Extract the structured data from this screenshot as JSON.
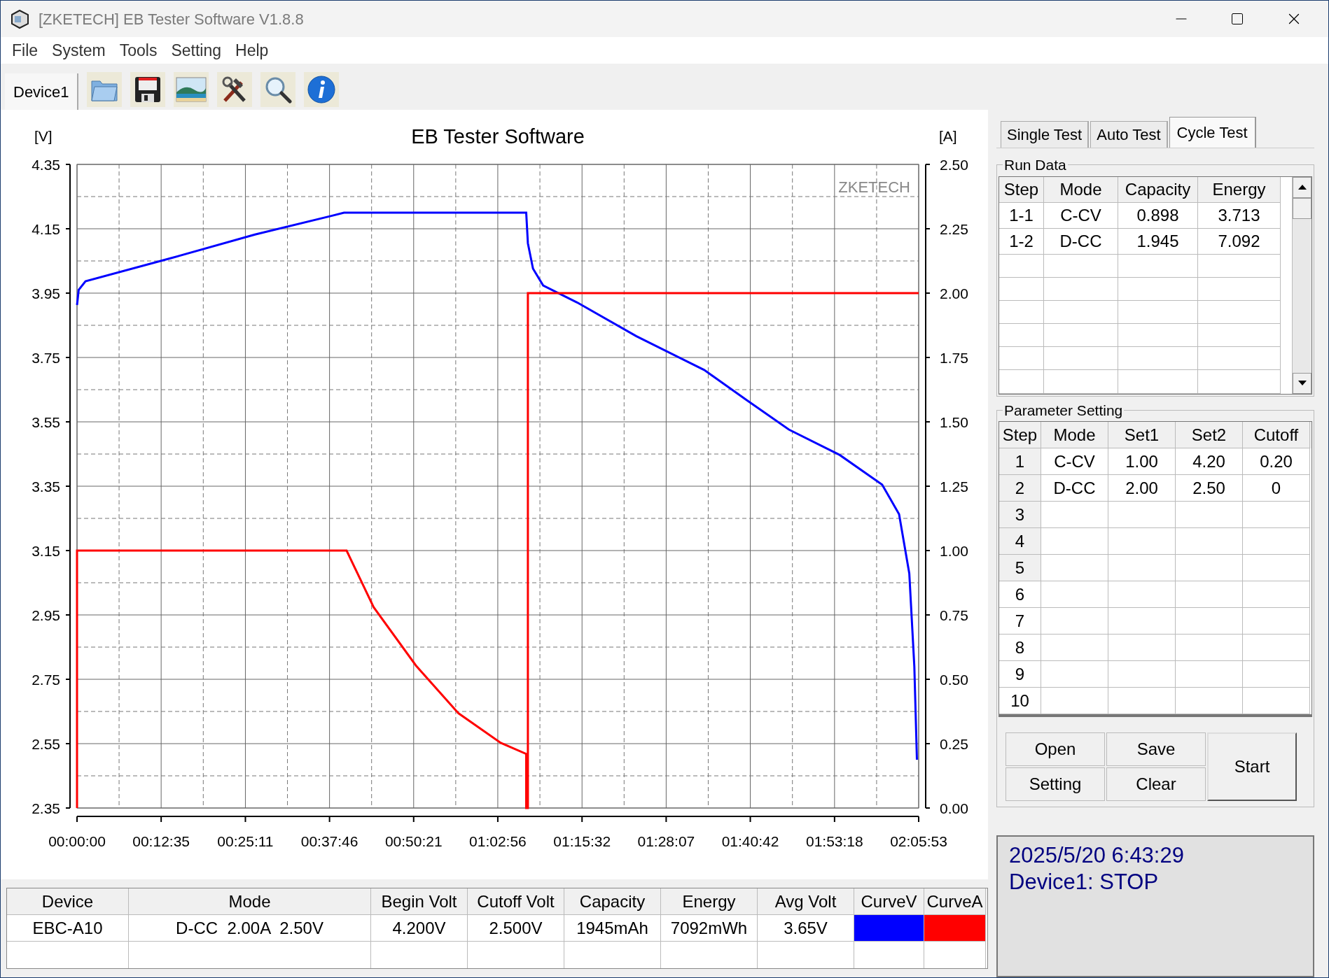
{
  "window": {
    "title": "[ZKETECH] EB Tester Software V1.8.8"
  },
  "menu": [
    "File",
    "System",
    "Tools",
    "Setting",
    "Help"
  ],
  "toolbar": {
    "device_tabs": [
      {
        "label": "Device1",
        "selected": true
      }
    ],
    "tools": [
      {
        "kind": "folder"
      },
      {
        "kind": "save"
      },
      {
        "kind": "picture"
      },
      {
        "kind": "tools"
      },
      {
        "kind": "search"
      },
      {
        "kind": "info"
      }
    ]
  },
  "chart": {
    "left_unit": "[V]",
    "right_unit": "[A]",
    "brand_label": "ZKETECH",
    "chart_data": {
      "type": "line",
      "title": "EB Tester Software",
      "grid": true,
      "y2lim": [
        0,
        2.5
      ],
      "y2ticks": [
        {
          "value": 0,
          "label": "0.00"
        },
        {
          "value": 0.25,
          "label": "0.25"
        },
        {
          "value": 0.5,
          "label": "0.50"
        },
        {
          "value": 0.75,
          "label": "0.75"
        },
        {
          "value": 1,
          "label": "1.00"
        },
        {
          "value": 1.25,
          "label": "1.25"
        },
        {
          "value": 1.5,
          "label": "1.50"
        },
        {
          "value": 1.75,
          "label": "1.75"
        },
        {
          "value": 2,
          "label": "2.00"
        },
        {
          "value": 2.25,
          "label": "2.25"
        },
        {
          "value": 2.5,
          "label": "2.50"
        }
      ],
      "x": [
        0,
        0,
        15,
        76,
        837,
        1597,
        2282,
        2396,
        2419,
        2662,
        3042,
        3423,
        3803,
        4031,
        4031,
        4046,
        4046,
        4092,
        4183,
        4487,
        5020,
        5628,
        6008,
        6388,
        6845,
        7225,
        7377,
        7469,
        7514,
        7537,
        7553
      ],
      "series": [
        {
          "name": "CurveV",
          "color": "#0000ff",
          "axis": "y",
          "values": [
            3.913,
            3.913,
            3.96,
            3.987,
            4.058,
            4.132,
            4.19,
            4.2,
            4.2,
            4.2,
            4.2,
            4.2,
            4.2,
            4.2,
            4.2,
            4.105,
            4.105,
            4.026,
            3.974,
            3.921,
            3.816,
            3.711,
            3.618,
            3.526,
            3.447,
            3.355,
            3.263,
            3.079,
            2.79,
            2.5,
            null
          ]
        },
        {
          "name": "CurveA",
          "color": "#ff0000",
          "axis": "y2",
          "values": [
            0,
            1,
            1,
            1,
            1,
            1,
            1,
            1,
            1,
            0.78,
            0.553,
            0.368,
            0.253,
            0.21,
            0,
            0,
            2,
            2,
            2,
            2,
            2,
            2,
            2,
            2,
            2,
            2,
            2,
            2,
            2,
            2,
            2
          ]
        }
      ],
      "xlim": [
        0,
        7553
      ],
      "ylim": [
        2.35,
        4.35
      ],
      "xticks": [
        {
          "value": 0,
          "label": "00:00:00"
        },
        {
          "value": 755,
          "label": "00:12:35"
        },
        {
          "value": 1511,
          "label": "00:25:11"
        },
        {
          "value": 2266,
          "label": "00:37:46"
        },
        {
          "value": 3021,
          "label": "00:50:21"
        },
        {
          "value": 3776,
          "label": "01:02:56"
        },
        {
          "value": 4532,
          "label": "01:15:32"
        },
        {
          "value": 5287,
          "label": "01:28:07"
        },
        {
          "value": 6042,
          "label": "01:40:42"
        },
        {
          "value": 6798,
          "label": "01:53:18"
        },
        {
          "value": 7553,
          "label": "02:05:53"
        }
      ],
      "yticks": [
        {
          "value": 2.35,
          "label": "2.35"
        },
        {
          "value": 2.55,
          "label": "2.55"
        },
        {
          "value": 2.75,
          "label": "2.75"
        },
        {
          "value": 2.95,
          "label": "2.95"
        },
        {
          "value": 3.15,
          "label": "3.15"
        },
        {
          "value": 3.35,
          "label": "3.35"
        },
        {
          "value": 3.55,
          "label": "3.55"
        },
        {
          "value": 3.75,
          "label": "3.75"
        },
        {
          "value": 3.95,
          "label": "3.95"
        },
        {
          "value": 4.15,
          "label": "4.15"
        },
        {
          "value": 4.35,
          "label": "4.35"
        }
      ]
    }
  },
  "summary_table": {
    "columns": [
      "Device",
      "Mode",
      "Begin Volt",
      "Cutoff Volt",
      "Capacity",
      "Energy",
      "Avg Volt"
    ],
    "rows": [
      {
        "cells": [
          "EBC-A10",
          "D-CC  2.00A  2.50V",
          "4.200V",
          "2.500V",
          "1945mAh",
          "7092mWh",
          "3.65V"
        ]
      }
    ]
  },
  "tabs": [
    {
      "label": "Single Test",
      "selected": false
    },
    {
      "label": "Auto Test",
      "selected": false
    },
    {
      "label": "Cycle Test",
      "selected": true
    }
  ],
  "run_data": {
    "title": "Run Data",
    "columns": [
      "Step",
      "Mode",
      "Capacity",
      "Energy"
    ],
    "rows": [
      [
        "1-1",
        "C-CV",
        "0.898",
        "3.713"
      ],
      [
        "1-2",
        "D-CC",
        "1.945",
        "7.092"
      ]
    ]
  },
  "parameter_setting": {
    "title": "Parameter Setting",
    "columns": [
      "Step",
      "Mode",
      "Set1",
      "Set2",
      "Cutoff"
    ],
    "rows": [
      {
        "cells": [
          "1",
          "C-CV",
          "1.00",
          "4.20",
          "0.20"
        ],
        "highlighted": true
      },
      {
        "cells": [
          "2",
          "D-CC",
          "2.00",
          "2.50",
          "0"
        ],
        "highlighted": true
      },
      {
        "cells": [
          "3"
        ],
        "highlighted": true
      },
      {
        "cells": [
          "4"
        ],
        "highlighted": true
      },
      {
        "cells": [
          "5"
        ],
        "highlighted": true
      },
      {
        "cells": [
          "6"
        ],
        "highlighted": false
      },
      {
        "cells": [
          "7"
        ],
        "highlighted": false
      },
      {
        "cells": [
          "8"
        ],
        "highlighted": false
      },
      {
        "cells": [
          "9"
        ],
        "highlighted": false
      },
      {
        "cells": [
          "10"
        ],
        "highlighted": false
      }
    ]
  },
  "buttons": [
    {
      "label": "Open",
      "kind": "small"
    },
    {
      "label": "Save",
      "kind": "small"
    },
    {
      "label": "Setting",
      "kind": "small"
    },
    {
      "label": "Clear",
      "kind": "small"
    },
    {
      "label": "Start",
      "kind": "large"
    }
  ],
  "status": {
    "lines": [
      "2025/5/20 6:43:29",
      "Device1: STOP"
    ]
  }
}
